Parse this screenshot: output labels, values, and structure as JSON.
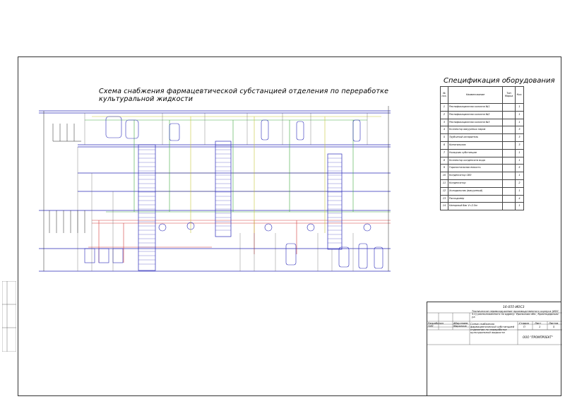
{
  "diagram": {
    "title": "Схема снабжения фармацевтической субстанцией отделения по переработке культуральной жидкости"
  },
  "specification": {
    "title": "Спецификация оборудования",
    "headers": {
      "num": "№ поз.",
      "name": "Наименование",
      "type": "Тип Марка",
      "qty": "Кол."
    },
    "rows": [
      {
        "num": "1",
        "name": "Ректификационная колонна №1",
        "qty": "1"
      },
      {
        "num": "2",
        "name": "Ректификационная колонна №2",
        "qty": "1"
      },
      {
        "num": "3",
        "name": "Ректификационная колонна №3",
        "qty": "1"
      },
      {
        "num": "4",
        "name": "Коллектор вакуумных паров",
        "qty": "3"
      },
      {
        "num": "5",
        "name": "Трубчатый испаритель",
        "qty": "3"
      },
      {
        "num": "6",
        "name": "Кипятильник",
        "qty": "3"
      },
      {
        "num": "7",
        "name": "Укладчик субстанции",
        "qty": "1"
      },
      {
        "num": "8",
        "name": "Коллектор конденсата вода",
        "qty": "1"
      },
      {
        "num": "9",
        "name": "Горизонтальная емкость",
        "qty": "5"
      },
      {
        "num": "10",
        "name": "Конденсатор СВЗ",
        "qty": "1"
      },
      {
        "num": "11",
        "name": "Конденсатор",
        "qty": "2"
      },
      {
        "num": "12",
        "name": "Холодильник (вакуумный)",
        "qty": "1"
      },
      {
        "num": "13",
        "name": "Расходомер",
        "qty": "4"
      },
      {
        "num": "14",
        "name": "Напорный бак V=2.5м",
        "qty": "1"
      }
    ]
  },
  "title_block": {
    "code": "16-055-ИОС3",
    "object_name": "Техническое перевооружение производственного корпуса (ИОС 3.1) расположенного по адресу: Уральская обл., Краснодарская ул.",
    "drawing_name": "Схема снабжения фармацевтической субстанцией отделения по переработке культуральной жидкости",
    "sheet_label": "Стадия",
    "sheet_label2": "Лист",
    "sheets_label": "Листов",
    "stage": "П",
    "sheet": "1",
    "sheets": "5",
    "organization": "ООО \"ПРОМПРОЕКТ\"",
    "role1": "Разработал",
    "role2": "ГИП",
    "person1": "Абдуллаев",
    "person2": "Маркелов"
  },
  "colors": {
    "process": "#2a2ab8",
    "steam": "#d33b3b",
    "gas": "#44aa44",
    "sub": "#c9c93a",
    "line": "#222222"
  }
}
